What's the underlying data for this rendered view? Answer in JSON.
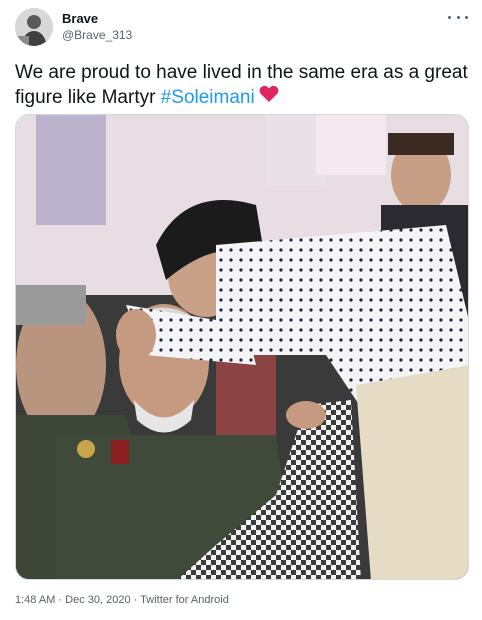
{
  "author": {
    "name": "Brave",
    "handle": "@Brave_313"
  },
  "tweet": {
    "text_before": "We are proud to have lived in the same era as a great figure like Martyr ",
    "hashtag": "#Soleimani",
    "emoji": "red-heart-icon"
  },
  "media": {
    "description_icon": "photo"
  },
  "meta": {
    "time": "1:48 AM",
    "separator1": " · ",
    "date": "Dec 30, 2020",
    "separator2": " · ",
    "source": "Twitter for Android"
  },
  "colors": {
    "link": "#1d9bf0",
    "secondary_text": "#536471",
    "heart": "#e0245e"
  }
}
